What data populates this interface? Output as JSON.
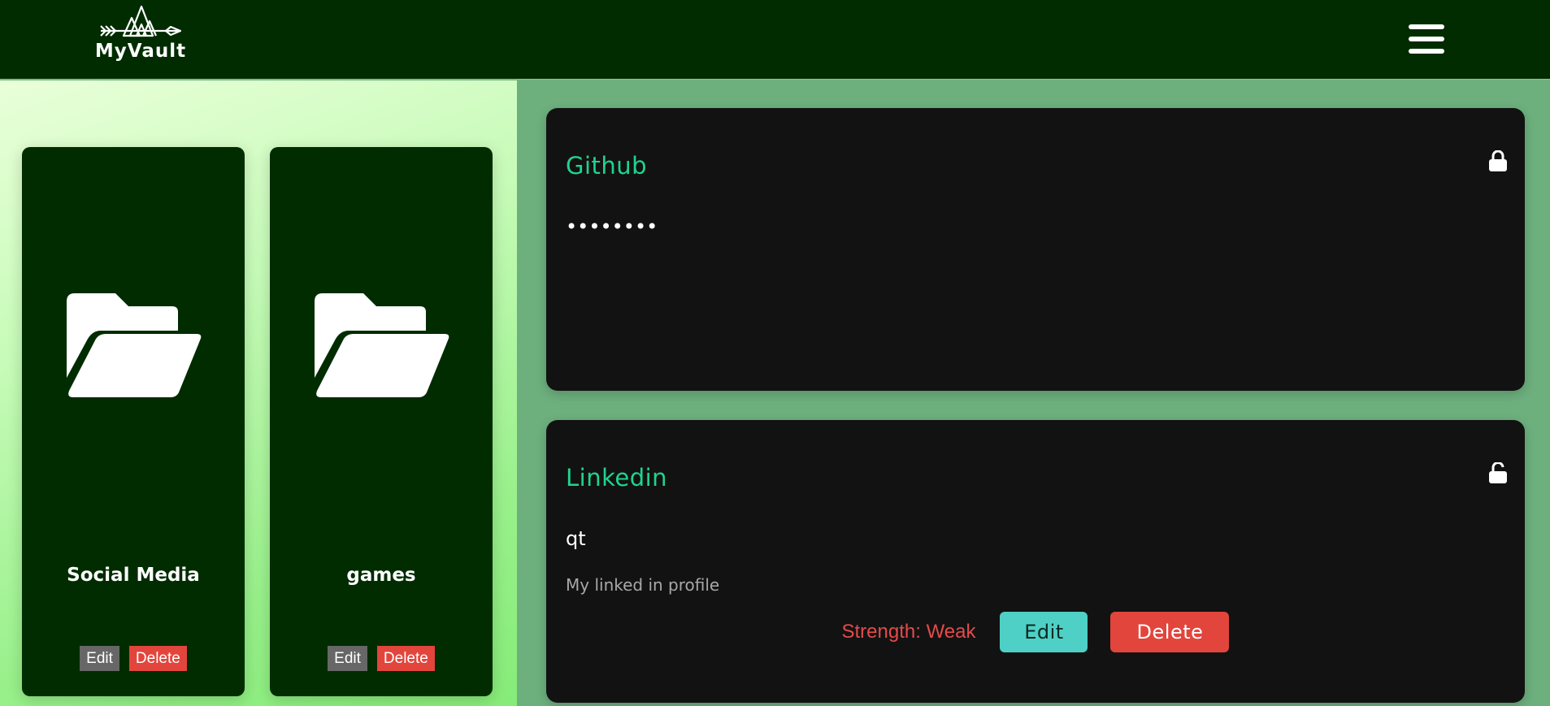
{
  "header": {
    "logo_text": "MyVault",
    "menu_icon": "hamburger-icon"
  },
  "folders": [
    {
      "name": "Social Media",
      "edit_label": "Edit",
      "delete_label": "Delete",
      "icon": "folder-open-icon"
    },
    {
      "name": "games",
      "edit_label": "Edit",
      "delete_label": "Delete",
      "icon": "folder-open-icon"
    }
  ],
  "credentials": [
    {
      "title": "Github",
      "secret": "••••••••",
      "locked": true,
      "lock_icon": "lock-closed-icon"
    },
    {
      "title": "Linkedin",
      "secret": "qt",
      "note": "My linked in profile",
      "strength": "Strength: Weak",
      "edit_label": "Edit",
      "delete_label": "Delete",
      "locked": false,
      "lock_icon": "lock-open-icon"
    }
  ],
  "colors": {
    "header_bg": "#002c00",
    "card_dark": "#121212",
    "accent_green": "#1fd48e",
    "danger": "#e2453c",
    "teal": "#4fd0c6"
  }
}
